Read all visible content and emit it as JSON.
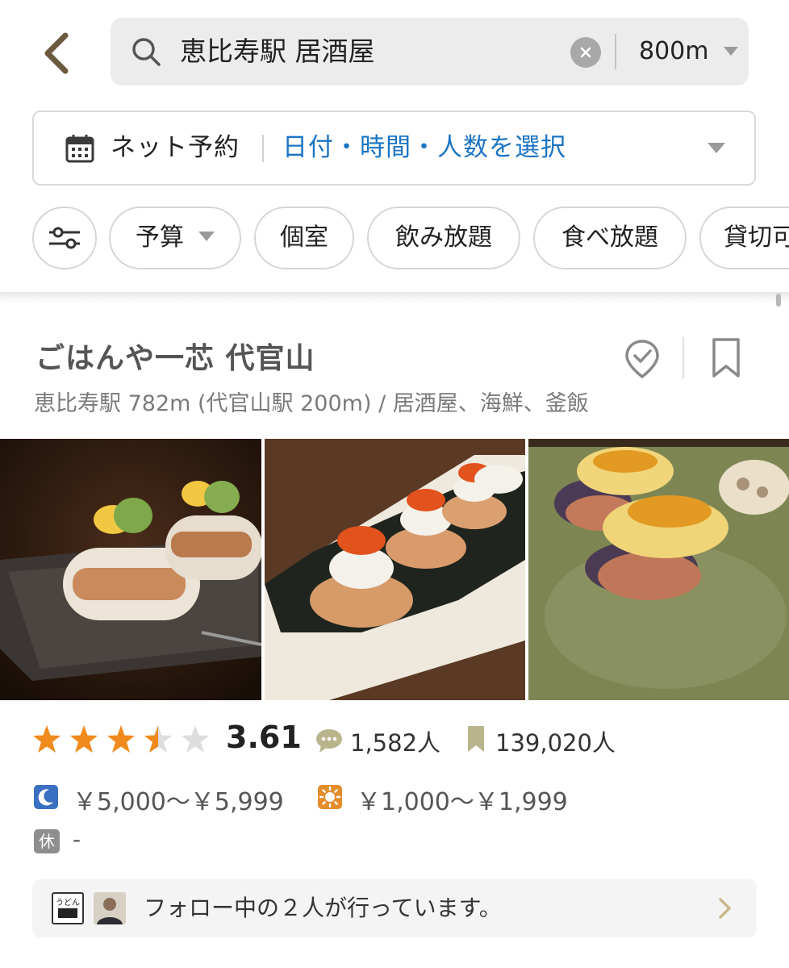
{
  "search": {
    "query": "恵比寿駅 居酒屋",
    "distance": "800m"
  },
  "reservation": {
    "label": "ネット予約",
    "select_prompt": "日付・時間・人数を選択"
  },
  "filters": [
    "予算",
    "個室",
    "飲み放題",
    "食べ放題",
    "貸切可"
  ],
  "restaurant": {
    "name": "ごはんや一芯 代官山",
    "meta": "恵比寿駅 782m (代官山駅 200m) / 居酒屋、海鮮、釜飯",
    "rating": "3.61",
    "rating_value": 3.61,
    "review_count": "1,582人",
    "bookmark_count": "139,020人",
    "dinner_price": "￥5,000～￥5,999",
    "lunch_price": "￥1,000～￥1,999",
    "holiday_badge": "休",
    "holiday": "-",
    "follow_text": "フォロー中の２人が行っています。",
    "avatar1_text": "うどん"
  },
  "colors": {
    "link_blue": "#1b74c4",
    "star_orange": "#f08a1c",
    "dinner_icon": "#3a6fc1",
    "lunch_icon": "#e38d2b"
  }
}
